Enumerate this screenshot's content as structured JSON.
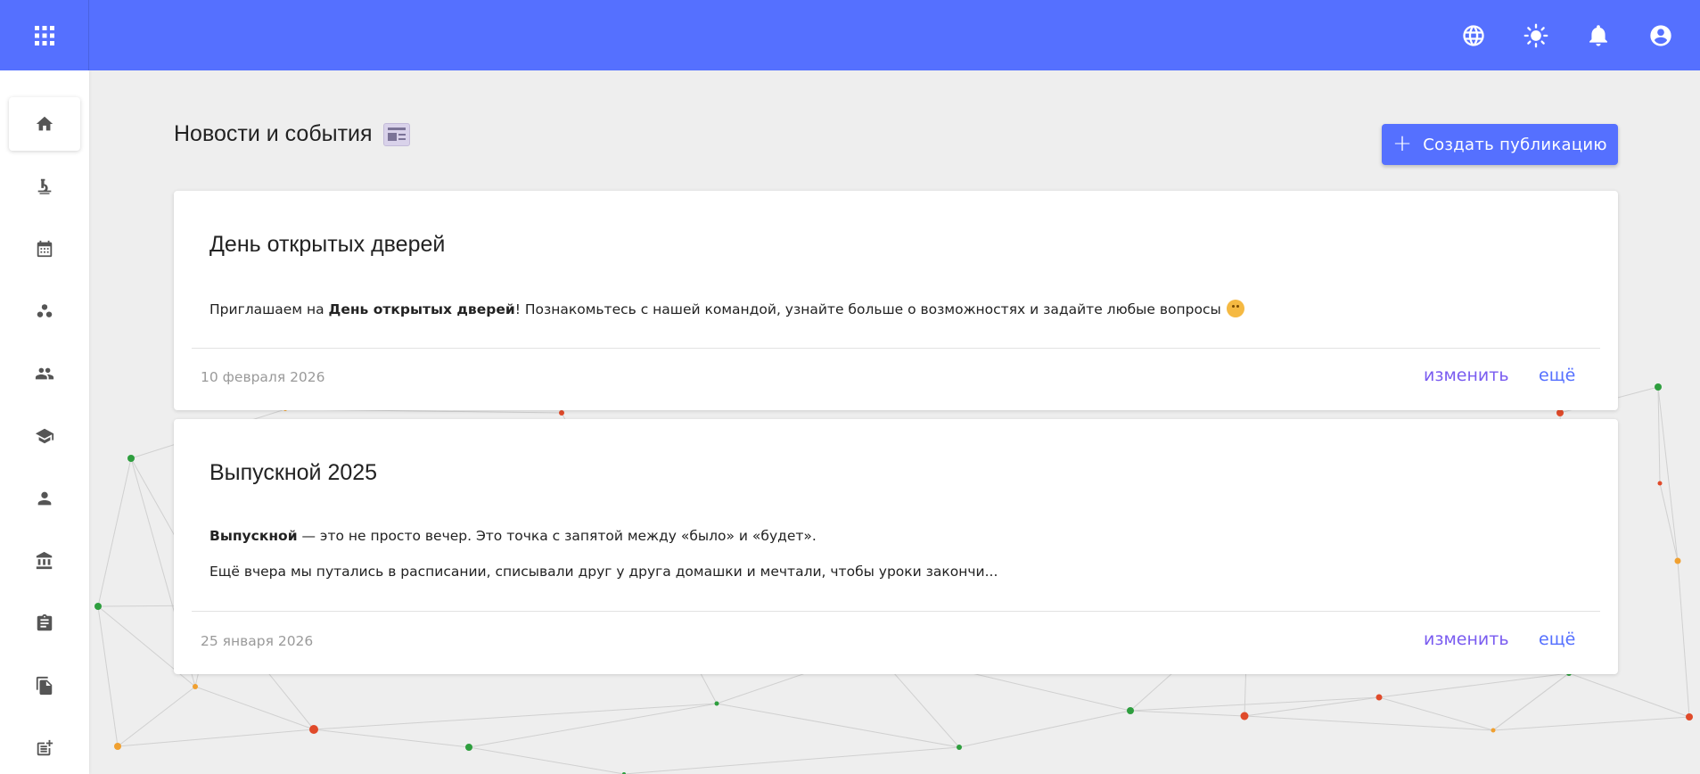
{
  "topbar": {
    "icons": [
      "apps-grid-icon",
      "globe-icon",
      "brightness-icon",
      "bell-icon",
      "account-circle-icon"
    ]
  },
  "sidebar": {
    "items": [
      {
        "icon": "home-icon",
        "active": true
      },
      {
        "icon": "microscope-icon",
        "active": false
      },
      {
        "icon": "calendar-icon",
        "active": false
      },
      {
        "icon": "bubbles-icon",
        "active": false
      },
      {
        "icon": "people-icon",
        "active": false
      },
      {
        "icon": "graduation-cap-icon",
        "active": false
      },
      {
        "icon": "person-icon",
        "active": false
      },
      {
        "icon": "bank-icon",
        "active": false
      },
      {
        "icon": "clipboard-icon",
        "active": false
      },
      {
        "icon": "files-icon",
        "active": false
      },
      {
        "icon": "post-add-icon",
        "active": false
      }
    ]
  },
  "main": {
    "title": "Новости и события",
    "create_button": {
      "label": "Создать публикацию",
      "icon": "plus-icon"
    },
    "posts": [
      {
        "title": "День открытых дверей",
        "body": [
          {
            "pre": "Приглашаем на ",
            "bold": "День открытых дверей",
            "post": "! Познакомьтесь с нашей командой, узнайте больше о возможностях и задайте любые вопросы"
          }
        ],
        "date": "10 февраля 2026",
        "edit_label": "изменить",
        "more_label": "ещё"
      },
      {
        "title": "Выпускной 2025",
        "body": [
          {
            "pre": "",
            "bold": "Выпускной",
            "post": " — это не просто вечер. Это точка с запятой между «было» и «будет»."
          },
          {
            "pre": "Ещё вчера мы путались в расписании, списывали друг у друга домашки и мечтали, чтобы уроки закончи...",
            "bold": "",
            "post": ""
          }
        ],
        "date": "25 января 2026",
        "edit_label": "изменить",
        "more_label": "ещё"
      }
    ]
  },
  "colors": {
    "primary": "#5570ff",
    "edit_link": "#7a5cf0",
    "background": "#eeeeee",
    "node_green": "#2e9e3e",
    "node_red": "#e04a2a",
    "node_orange": "#f0a030"
  }
}
